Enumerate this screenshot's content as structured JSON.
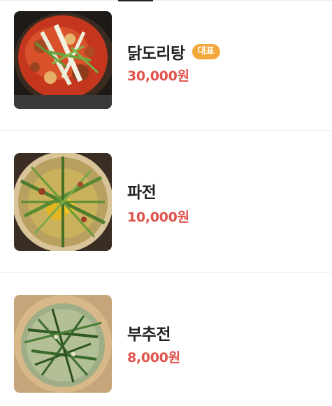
{
  "menu": {
    "items": [
      {
        "name": "닭도리탕",
        "badge": "대표",
        "price": "30,000원",
        "image_icon": "braised-chicken-stew-image"
      },
      {
        "name": "파전",
        "badge": "",
        "price": "10,000원",
        "image_icon": "scallion-pancake-image"
      },
      {
        "name": "부추전",
        "badge": "",
        "price": "8,000원",
        "image_icon": "chive-pancake-image"
      }
    ]
  },
  "colors": {
    "price": "#e0524b",
    "badge_bg": "#f2a93b",
    "name": "#222222"
  }
}
